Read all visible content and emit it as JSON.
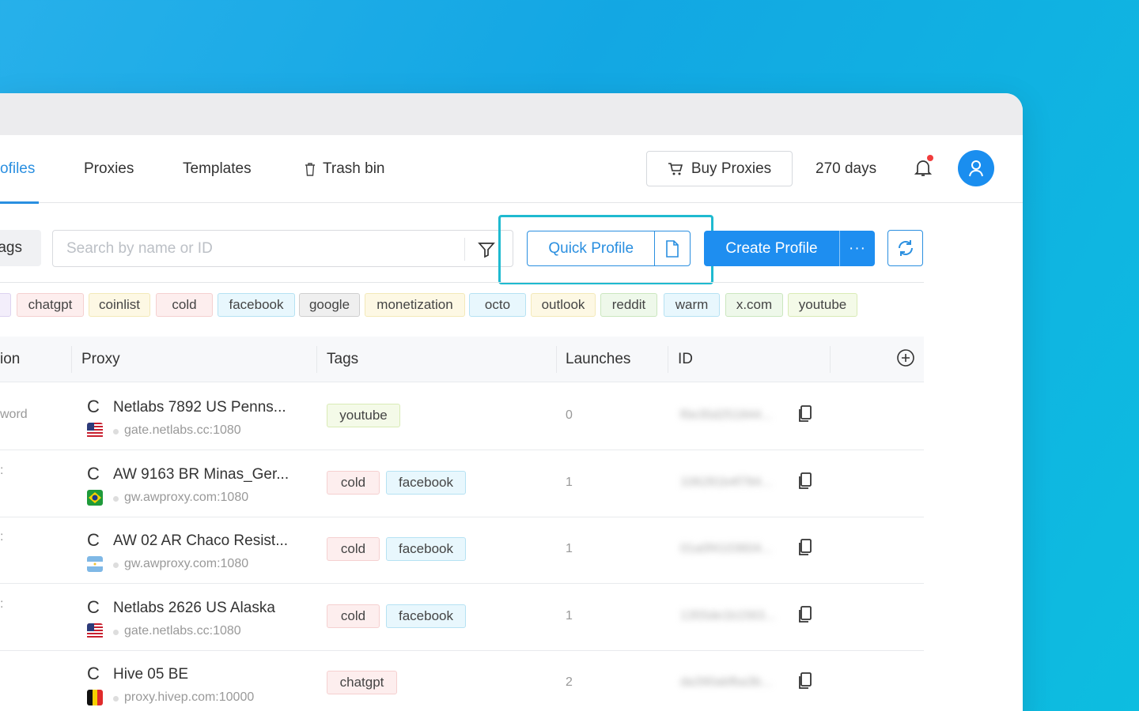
{
  "nav": {
    "profiles_label": "ofiles",
    "proxies_label": "Proxies",
    "templates_label": "Templates",
    "trash_label": "Trash bin",
    "buy_proxies_label": "Buy Proxies",
    "days_label": "270 days"
  },
  "toolbar": {
    "tags_label": "ags",
    "search_placeholder": "Search by name or ID",
    "quick_profile_label": "Quick Profile",
    "create_profile_label": "Create Profile",
    "more_label": "···"
  },
  "tag_chips": [
    {
      "label": "chatgpt",
      "bg": "#fdeeee",
      "border": "#f5d0d0"
    },
    {
      "label": "coinlist",
      "bg": "#fdf8e4",
      "border": "#f3e9b9"
    },
    {
      "label": "cold",
      "bg": "#fdeeee",
      "border": "#f5d0d0"
    },
    {
      "label": "facebook",
      "bg": "#e8f7fd",
      "border": "#b6e2f3"
    },
    {
      "label": "google",
      "bg": "#efefef",
      "border": "#cfcfcf"
    },
    {
      "label": "monetization",
      "bg": "#fdf8e4",
      "border": "#f3e9b9"
    },
    {
      "label": "octo",
      "bg": "#e8f7fd",
      "border": "#b6e2f3"
    },
    {
      "label": "outlook",
      "bg": "#fdf8e4",
      "border": "#f3e9b9"
    },
    {
      "label": "reddit",
      "bg": "#eef8ea",
      "border": "#cbe7bf"
    },
    {
      "label": "warm",
      "bg": "#e8f7fd",
      "border": "#b6e2f3"
    },
    {
      "label": "x.com",
      "bg": "#eef8ea",
      "border": "#cbe7bf"
    },
    {
      "label": "youtube",
      "bg": "#f4fae8",
      "border": "#d9ebb6"
    }
  ],
  "table": {
    "headers": {
      "col0": "ion",
      "proxy": "Proxy",
      "tags": "Tags",
      "launches": "Launches",
      "id": "ID"
    },
    "rows": [
      {
        "left": "word",
        "proxy_name": "Netlabs 7892 US Penns...",
        "proxy_host": "gate.netlabs.cc:1080",
        "flag": "us",
        "tags": [
          "youtube"
        ],
        "launches": "0",
        "id": "f0e35d251844..."
      },
      {
        "left": ":",
        "proxy_name": "AW 9163 BR Minas_Ger...",
        "proxy_host": "gw.awproxy.com:1080",
        "flag": "br",
        "tags": [
          "cold",
          "facebook"
        ],
        "launches": "1",
        "id": "106281b4f784..."
      },
      {
        "left": ":",
        "proxy_name": "AW 02 AR Chaco Resist...",
        "proxy_host": "gw.awproxy.com:1080",
        "flag": "ar",
        "tags": [
          "cold",
          "facebook"
        ],
        "launches": "1",
        "id": "01a0f4103604..."
      },
      {
        "left": ":",
        "proxy_name": "Netlabs 2626 US Alaska",
        "proxy_host": "gate.netlabs.cc:1080",
        "flag": "us",
        "tags": [
          "cold",
          "facebook"
        ],
        "launches": "1",
        "id": "1355de1b1563..."
      },
      {
        "left": "",
        "proxy_name": "Hive 05 BE",
        "proxy_host": "proxy.hivep.com:10000",
        "flag": "be",
        "tags": [
          "chatgpt"
        ],
        "launches": "2",
        "id": "da390abfba3b..."
      }
    ]
  },
  "colors": {
    "accent": "#2a8fe0",
    "highlight": "#1fbad0",
    "cold_bg": "#fdeeee",
    "facebook_bg": "#e8f7fd"
  }
}
